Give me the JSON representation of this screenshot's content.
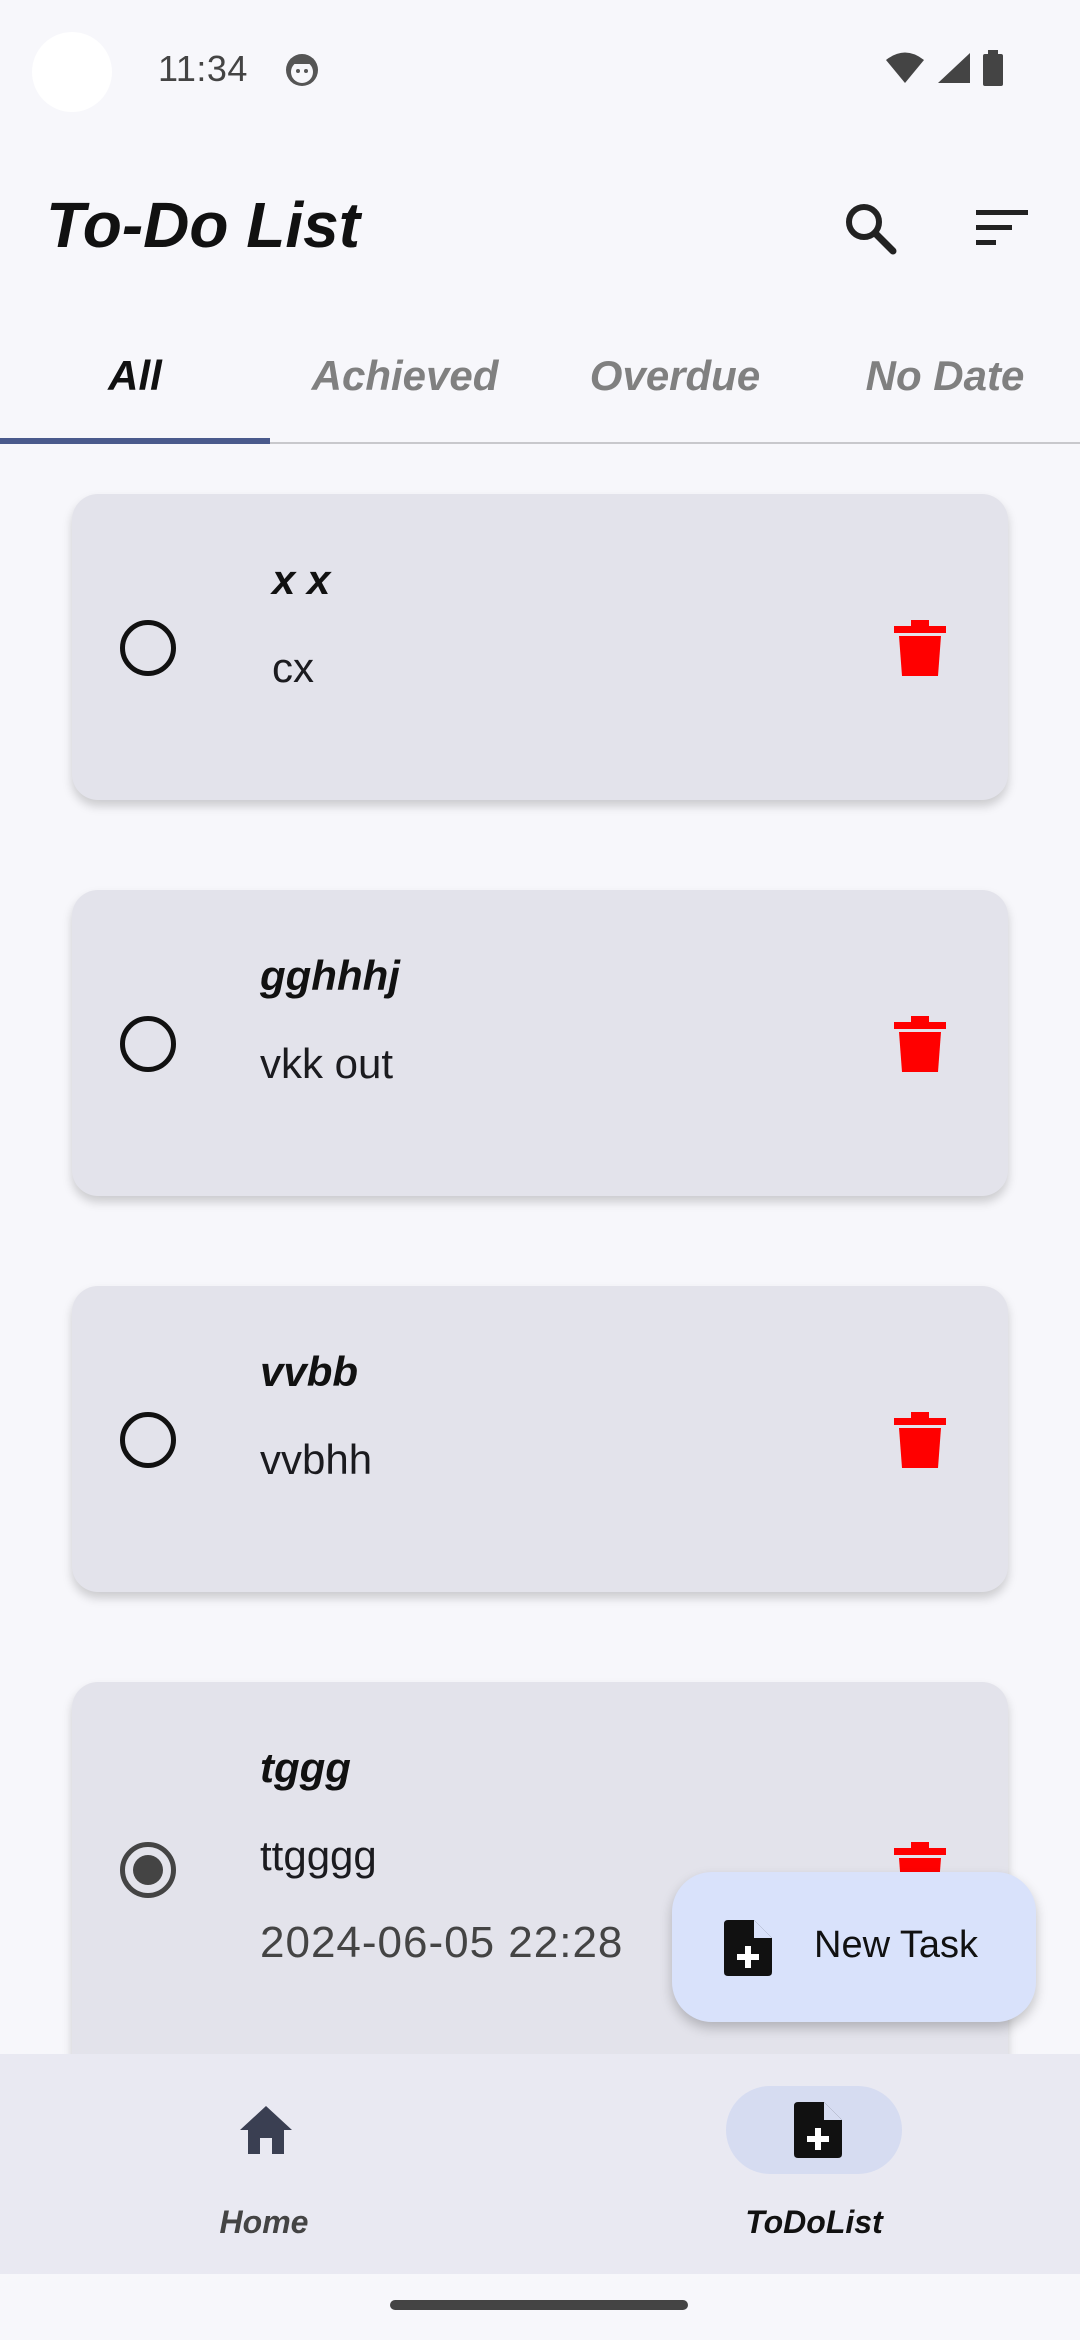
{
  "status_bar": {
    "time": "11:34"
  },
  "app_bar": {
    "title": "To-Do List",
    "icons": [
      "search-icon",
      "sort-icon"
    ]
  },
  "tabs": [
    {
      "label": "All",
      "active": true
    },
    {
      "label": "Achieved",
      "active": false
    },
    {
      "label": "Overdue",
      "active": false
    },
    {
      "label": "No Date",
      "active": false
    }
  ],
  "tasks": [
    {
      "title": "x x",
      "description": "cx",
      "date": "",
      "checked": false
    },
    {
      "title": "gghhhj",
      "description": "vkk out",
      "date": "",
      "checked": false
    },
    {
      "title": "vvbb",
      "description": "vvbhh",
      "date": "",
      "checked": false
    },
    {
      "title": "tggg",
      "description": "ttgggg",
      "date": "2024-06-05 22:28",
      "checked": true
    }
  ],
  "fab": {
    "label": "New Task",
    "icon": "new-file-icon"
  },
  "bottom_nav": {
    "items": [
      {
        "label": "Home",
        "icon": "home-icon",
        "active": false
      },
      {
        "label": "ToDoList",
        "icon": "new-file-icon",
        "active": true
      }
    ]
  },
  "colors": {
    "accent": "#4a5a8c",
    "delete": "#ff0000",
    "card_bg": "#e3e3eb",
    "fab_bg": "#d9e2fb"
  }
}
